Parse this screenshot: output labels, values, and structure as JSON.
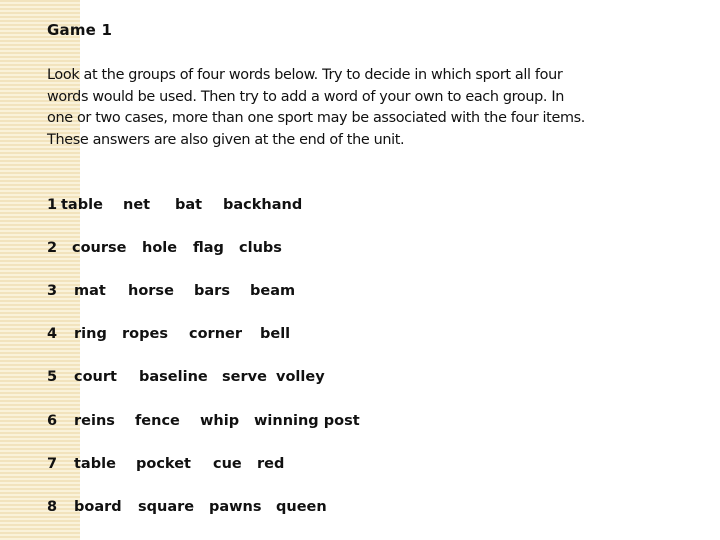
{
  "title": "Game 1",
  "intro": "Look at the groups of four words below. Try to decide in which sport all four words would be used. Then try to add a word of your own to each group. In one or two cases, more than one sport may be associated with the four items. These answers are also given at the end of the unit.",
  "groups": [
    {
      "number": "1",
      "words": [
        "table",
        "net",
        "bat",
        "backhand"
      ]
    },
    {
      "number": "2",
      "words": [
        "course",
        "hole",
        "flag",
        "clubs"
      ]
    },
    {
      "number": "3",
      "words": [
        "mat",
        "horse",
        "bars",
        "beam"
      ]
    },
    {
      "number": "4",
      "words": [
        "ring",
        "ropes",
        "corner",
        "bell"
      ]
    },
    {
      "number": "5",
      "words": [
        "court",
        "baseline",
        "serve",
        "volley"
      ]
    },
    {
      "number": "6",
      "words": [
        "reins",
        "fence",
        "whip",
        "winning post"
      ]
    },
    {
      "number": "7",
      "words": [
        "table",
        "pocket",
        "cue",
        "red"
      ]
    },
    {
      "number": "8",
      "words": [
        "board",
        "square",
        "pawns",
        "queen"
      ]
    }
  ]
}
